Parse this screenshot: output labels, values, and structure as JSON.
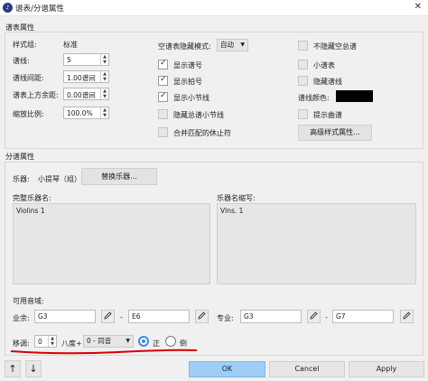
{
  "window": {
    "title": "谱表/分谱属性",
    "app_icon": "musescore-icon"
  },
  "staff_props": {
    "section_label": "谱表属性",
    "style_label": "样式组:",
    "style_value": "标准",
    "lines_label": "谱线:",
    "lines_value": "5",
    "spacing_label": "谱线间距:",
    "spacing_value": "1.00谱间",
    "extra_dist_label": "谱表上方余距:",
    "extra_dist_value": "0.00谱间",
    "scale_label": "缩放比例:",
    "scale_value": "100.0%",
    "hide_mode_label": "空谱表隐藏模式:",
    "hide_mode_value": "自动",
    "show_clef": "显示谱号",
    "show_timesig": "显示拍号",
    "show_barlines": "显示小节线",
    "hide_sys_barlines": "隐藏总谱小节线",
    "merge_rests": "合并匹配的休止符",
    "no_hide_empty": "不隐藏空总谱",
    "small_staff": "小谱表",
    "invisible_lines": "隐藏谱线",
    "line_color_label": "谱线颜色:",
    "line_color": "#000000",
    "cue_notes": "提示曲谱",
    "advanced_btn": "高级样式属性..."
  },
  "part_props": {
    "section_label": "分谱属性",
    "instrument_label": "乐器:",
    "instrument_value": "小提琴（组）",
    "change_btn": "替换乐器...",
    "long_name_label": "完整乐器名:",
    "long_name_value": "Violins 1",
    "short_name_label": "乐器名缩写:",
    "short_name_value": "Vlns. 1",
    "range_label": "可用音域:",
    "amateur_label": "业余:",
    "amateur_low": "G3",
    "amateur_high": "E6",
    "pro_label": "专业:",
    "pro_low": "G3",
    "pro_high": "G7",
    "dash": "-",
    "transpose_label": "移调:",
    "octave_value": "0",
    "octave_label": "八度+",
    "interval_value": "0 - 同音",
    "up_label": "正",
    "down_label": "倒"
  },
  "footer": {
    "ok": "OK",
    "cancel": "Cancel",
    "apply": "Apply"
  },
  "colors": {
    "accent": "#3a8be0",
    "ok_bg": "#9fcdf5",
    "underline": "#d40000"
  }
}
